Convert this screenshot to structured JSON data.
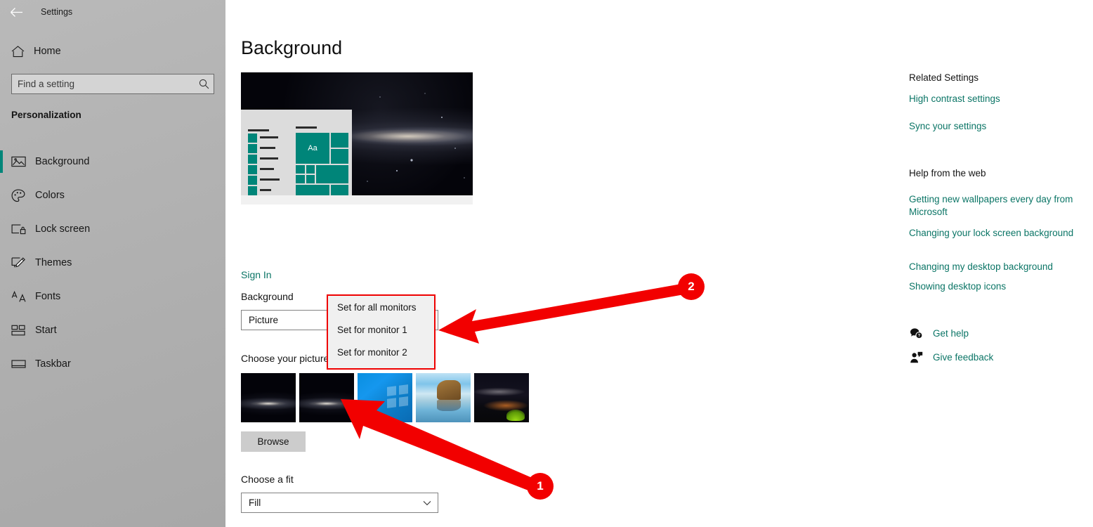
{
  "window": {
    "app_title": "Settings",
    "back_icon": "back-arrow-icon",
    "minimize_icon": "minimize-icon",
    "maximize_icon": "maximize-icon",
    "close_icon": "close-icon"
  },
  "sidebar": {
    "home_label": "Home",
    "home_icon": "home-icon",
    "search": {
      "placeholder": "Find a setting",
      "value": "",
      "icon": "search-icon"
    },
    "group_title": "Personalization",
    "items": [
      {
        "label": "Background",
        "icon": "picture-icon",
        "selected": true
      },
      {
        "label": "Colors",
        "icon": "palette-icon",
        "selected": false
      },
      {
        "label": "Lock screen",
        "icon": "lock-screen-icon",
        "selected": false
      },
      {
        "label": "Themes",
        "icon": "themes-brush-icon",
        "selected": false
      },
      {
        "label": "Fonts",
        "icon": "fonts-aa-icon",
        "selected": false
      },
      {
        "label": "Start",
        "icon": "start-tiles-icon",
        "selected": false
      },
      {
        "label": "Taskbar",
        "icon": "taskbar-icon",
        "selected": false
      }
    ]
  },
  "main": {
    "page_title": "Background",
    "preview_alt": "desktop-preview-milky-way-wallpaper",
    "preview_tile_text": "Aa",
    "sign_in_link": "Sign In",
    "background_label": "Background",
    "background_value": "Picture",
    "choose_picture_label": "Choose your picture",
    "browse_label": "Browse",
    "choose_fit_label": "Choose a fit",
    "fit_value": "Fill",
    "chevron_icon": "chevron-down-icon",
    "thumbnails": [
      {
        "name": "milky-way-1",
        "style": "galaxy-a"
      },
      {
        "name": "milky-way-2",
        "style": "galaxy-a"
      },
      {
        "name": "windows-10-logo",
        "style": "win10"
      },
      {
        "name": "beach-rock-arch",
        "style": "beach"
      },
      {
        "name": "night-camping-aurora",
        "style": "camp"
      }
    ]
  },
  "context_menu": {
    "items": [
      "Set for all monitors",
      "Set for monitor 1",
      "Set for monitor 2"
    ]
  },
  "right_pane": {
    "related_settings_heading": "Related Settings",
    "related_links": [
      "High contrast settings",
      "Sync your settings"
    ],
    "help_heading": "Help from the web",
    "help_links": [
      "Getting new wallpapers every day from Microsoft",
      "Changing your lock screen background",
      "Changing my desktop background",
      "Showing desktop icons"
    ],
    "get_help_label": "Get help",
    "get_help_icon": "help-bubble-icon",
    "give_feedback_label": "Give feedback",
    "give_feedback_icon": "feedback-person-icon"
  },
  "annotations": {
    "badge_1": "1",
    "badge_2": "2"
  },
  "colors": {
    "accent_teal": "#008579",
    "link_teal": "#0b7566",
    "annotation_red": "#f20000",
    "menu_border_red": "#ee0000",
    "sidebar_gray": "#b2b2b2"
  }
}
